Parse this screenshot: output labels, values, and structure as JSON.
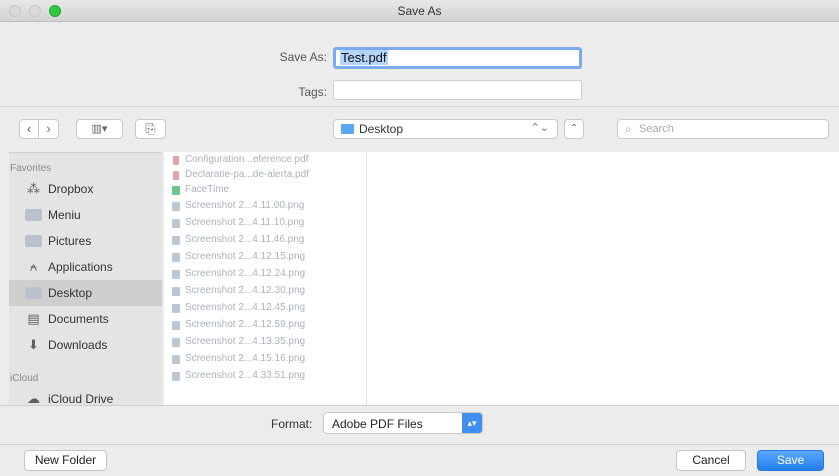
{
  "window": {
    "title": "Save As"
  },
  "form": {
    "save_as_label": "Save As:",
    "save_as_value": "Test.pdf",
    "tags_label": "Tags:",
    "tags_value": ""
  },
  "toolbar": {
    "back": "‹",
    "forward": "›",
    "view": "▥▾",
    "new_folder_icon": "⎘",
    "location": "Desktop",
    "location_arrows": "⌃⌄",
    "expand": "⌃",
    "search_placeholder": "Search"
  },
  "sidebar": {
    "favorites_header": "Favorites",
    "icloud_header": "iCloud",
    "items": [
      {
        "label": "Dropbox",
        "icon": "dropbox-icon",
        "glyph": "⁂"
      },
      {
        "label": "Meniu",
        "icon": "folder-icon",
        "glyph": ""
      },
      {
        "label": "Pictures",
        "icon": "folder-icon",
        "glyph": ""
      },
      {
        "label": "Applications",
        "icon": "applications-icon",
        "glyph": "⍲"
      },
      {
        "label": "Desktop",
        "icon": "folder-icon",
        "glyph": "",
        "selected": true
      },
      {
        "label": "Documents",
        "icon": "documents-icon",
        "glyph": "▤"
      },
      {
        "label": "Downloads",
        "icon": "downloads-icon",
        "glyph": "⬇"
      }
    ],
    "icloud_items": [
      {
        "label": "iCloud Drive",
        "icon": "cloud-icon",
        "glyph": "☁"
      }
    ]
  },
  "files": [
    {
      "name": "Configuration...eference.pdf",
      "type": "pdf"
    },
    {
      "name": "Declaratie-pa...de-alerta.pdf",
      "type": "pdf"
    },
    {
      "name": "FaceTime",
      "type": "app"
    },
    {
      "name": "Screenshot 2...4.11.00.png",
      "type": "image"
    },
    {
      "name": "Screenshot 2...4.11.10.png",
      "type": "image"
    },
    {
      "name": "Screenshot 2...4.11.46.png",
      "type": "image"
    },
    {
      "name": "Screenshot 2...4.12.15.png",
      "type": "image"
    },
    {
      "name": "Screenshot 2...4.12.24.png",
      "type": "image"
    },
    {
      "name": "Screenshot 2...4.12.30.png",
      "type": "image"
    },
    {
      "name": "Screenshot 2...4.12.45.png",
      "type": "image"
    },
    {
      "name": "Screenshot 2...4.12.59.png",
      "type": "image"
    },
    {
      "name": "Screenshot 2...4.13.35.png",
      "type": "image"
    },
    {
      "name": "Screenshot 2...4.15.16.png",
      "type": "image"
    },
    {
      "name": "Screenshot 2...4.33.51.png",
      "type": "image"
    }
  ],
  "format": {
    "label": "Format:",
    "value": "Adobe PDF Files",
    "arrows": "▴▾"
  },
  "buttons": {
    "new_folder": "New Folder",
    "cancel": "Cancel",
    "save": "Save"
  },
  "colors": {
    "accent": "#3f8ef2",
    "zoom_button": "#2ec93f"
  }
}
